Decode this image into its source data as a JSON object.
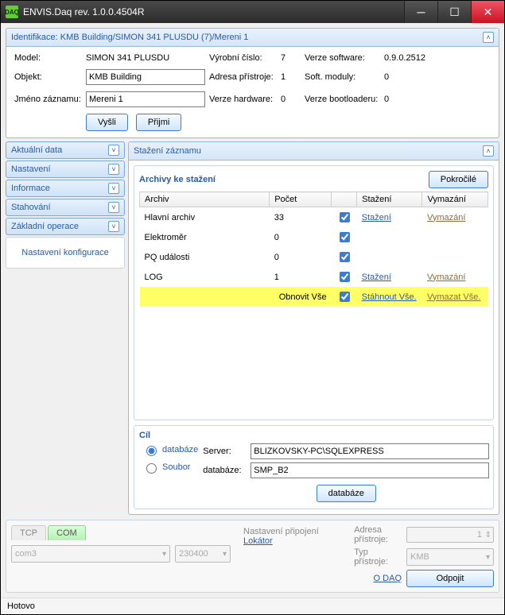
{
  "app": {
    "title": "ENVIS.Daq rev. 1.0.0.4504R",
    "icon_text": "DAQ"
  },
  "identification": {
    "header": "Identifikace: KMB Building/SIMON 341 PLUSDU (7)/Mereni 1",
    "labels": {
      "model": "Model:",
      "object": "Objekt:",
      "record_name": "Jméno záznamu:",
      "serial": "Výrobní číslo:",
      "address": "Adresa přístroje:",
      "hw": "Verze hardware:",
      "sw": "Verze software:",
      "modules": "Soft. moduly:",
      "boot": "Verze bootloaderu:"
    },
    "values": {
      "model": "SIMON 341 PLUSDU",
      "object": "KMB Building",
      "record_name": "Mereni 1",
      "serial": "7",
      "address": "1",
      "hw": "0",
      "sw": "0.9.0.2512",
      "modules": "0",
      "boot": "0"
    },
    "buttons": {
      "send": "Vyšli",
      "receive": "Přijmi"
    }
  },
  "sidebar": {
    "items": [
      {
        "label": "Aktuální data"
      },
      {
        "label": "Nastavení"
      },
      {
        "label": "Informace"
      },
      {
        "label": "Stahování"
      },
      {
        "label": "Základní operace"
      }
    ],
    "config_btn": "Nastavení konfigurace"
  },
  "download": {
    "header": "Stažení záznamu",
    "archives_title": "Archivy ke stažení",
    "advanced": "Pokročilé",
    "columns": {
      "archive": "Archiv",
      "count": "Počet",
      "chk": "",
      "download": "Stažení",
      "erase": "Vymazání"
    },
    "rows": [
      {
        "archive": "Hlavní archiv",
        "count": "33",
        "checked": true,
        "dl": "Stažení",
        "er": "Vymazání"
      },
      {
        "archive": "Elektroměr",
        "count": "0",
        "checked": true,
        "dl": "",
        "er": ""
      },
      {
        "archive": "PQ události",
        "count": "0",
        "checked": true,
        "dl": "",
        "er": ""
      },
      {
        "archive": "LOG",
        "count": "1",
        "checked": true,
        "dl": "Stažení",
        "er": "Vymazání"
      }
    ],
    "footer": {
      "refresh": "Obnovit Vše",
      "checked": true,
      "dl_all": "Stáhnout Vše.",
      "er_all": "Vymazat Vše."
    }
  },
  "target": {
    "title": "Cíl",
    "radios": {
      "db": "databáze",
      "file": "Soubor"
    },
    "labels": {
      "server": "Server:",
      "database": "databáze:"
    },
    "values": {
      "server": "BLIZKOVSKY-PC\\SQLEXPRESS",
      "database": "SMP_B2"
    },
    "button": "databáze"
  },
  "connection": {
    "tabs": {
      "tcp": "TCP",
      "com": "COM"
    },
    "settings_label": "Nastavení připojení",
    "locator": "Lokátor",
    "port": "com3",
    "baud": "230400",
    "addr_label": "Adresa přístroje:",
    "addr_value": "1",
    "type_label": "Typ přístroje:",
    "type_value": "KMB",
    "about": "O DAQ",
    "disconnect": "Odpojit"
  },
  "status": "Hotovo"
}
